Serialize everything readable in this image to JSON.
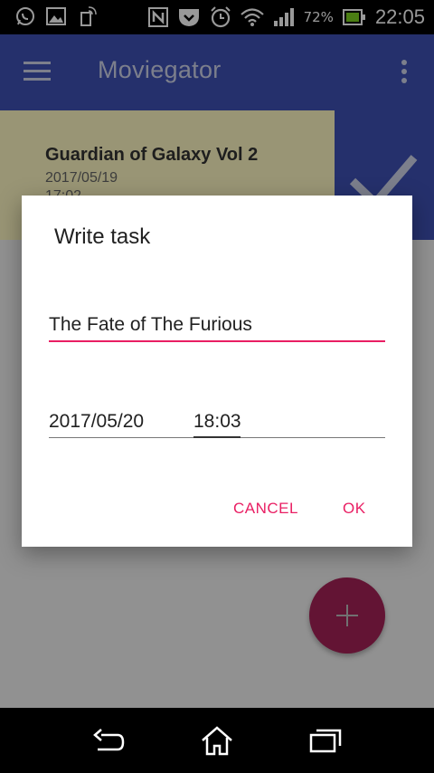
{
  "status_bar": {
    "battery_percent": "72%",
    "time": "22:05",
    "icons": [
      "whatsapp-icon",
      "image-icon",
      "phone-icon",
      "nfc-icon",
      "shield-icon",
      "alarm-icon",
      "wifi-icon",
      "signal-icon",
      "battery-icon"
    ]
  },
  "app_bar": {
    "title": "Moviegator",
    "menu_icon": "hamburger-menu-icon",
    "overflow_icon": "overflow-menu-icon",
    "color": "#3f51b5"
  },
  "list": {
    "items": [
      {
        "title": "Guardian of Galaxy Vol 2",
        "date": "2017/05/19",
        "time": "17:02"
      }
    ],
    "swipe_action_icon": "check-icon"
  },
  "dialog": {
    "title": "Write task",
    "task_value": "The Fate of The Furious",
    "date_value": "2017/05/20",
    "time_value": "18:03",
    "cancel_label": "CANCEL",
    "ok_label": "OK",
    "accent_color": "#e91e63"
  },
  "fab": {
    "icon": "plus-icon",
    "color": "#a52257"
  },
  "nav_bar": {
    "icons": [
      "back-icon",
      "home-icon",
      "recents-icon"
    ]
  }
}
